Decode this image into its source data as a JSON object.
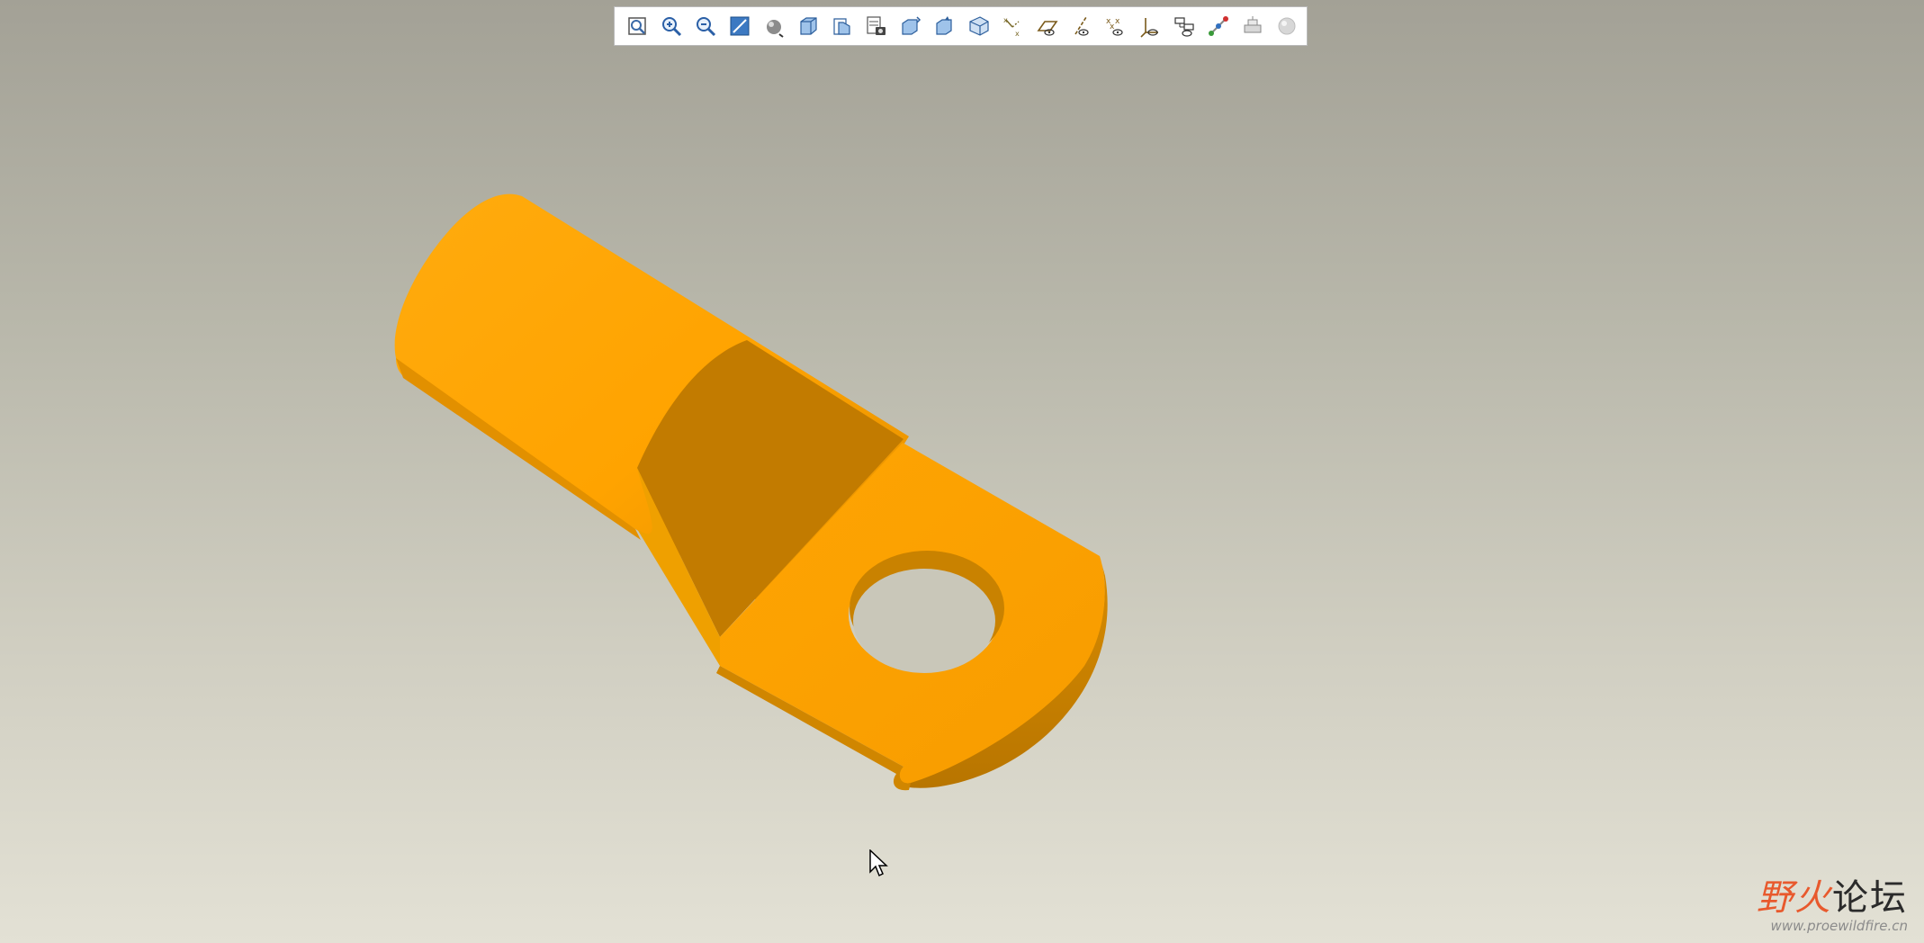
{
  "toolbar": {
    "buttons": [
      {
        "icon": "refit-icon"
      },
      {
        "icon": "zoom-in-icon"
      },
      {
        "icon": "zoom-out-icon"
      },
      {
        "icon": "repaint-icon"
      },
      {
        "icon": "spin-center-icon"
      },
      {
        "icon": "display-style-icon"
      },
      {
        "icon": "saved-views-icon"
      },
      {
        "icon": "view-manager-icon"
      },
      {
        "icon": "orient-icon"
      },
      {
        "icon": "reorient-icon"
      },
      {
        "icon": "perspective-icon"
      },
      {
        "icon": "annotation-display-icon"
      },
      {
        "icon": "plane-display-icon"
      },
      {
        "icon": "axis-display-icon"
      },
      {
        "icon": "point-display-icon"
      },
      {
        "icon": "csys-display-icon"
      },
      {
        "icon": "model-tree-icon"
      },
      {
        "icon": "sketch-display-icon"
      },
      {
        "icon": "appearance-icon"
      },
      {
        "icon": "render-sphere-icon"
      }
    ]
  },
  "model": {
    "color": "#ffa402",
    "shadow_color": "#c07a00"
  },
  "watermark": {
    "title_red": "野火",
    "title_dark": "论坛",
    "url": "www.proewildfire.cn"
  }
}
